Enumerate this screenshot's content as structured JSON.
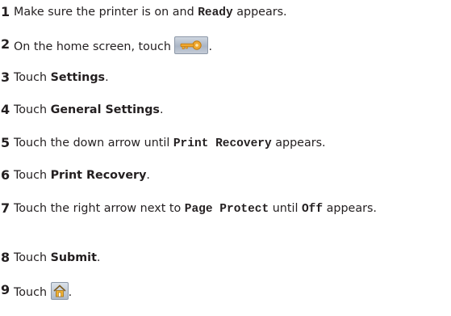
{
  "steps": [
    {
      "num": "1",
      "before": "Make sure the printer is on and ",
      "code": "Ready",
      "after": " appears."
    },
    {
      "num": "2",
      "before": "On the home screen, touch ",
      "icon": "menu-key-icon",
      "after": "."
    },
    {
      "num": "3",
      "before": "Touch ",
      "bold": "Settings",
      "after": "."
    },
    {
      "num": "4",
      "before": "Touch ",
      "bold": "General Settings",
      "after": "."
    },
    {
      "num": "5",
      "before": "Touch the down arrow until ",
      "code": "Print Recovery",
      "after": " appears."
    },
    {
      "num": "6",
      "before": "Touch ",
      "bold": "Print Recovery",
      "after": "."
    },
    {
      "num": "7",
      "before": "Touch the right arrow next to ",
      "code": "Page Protect",
      "middle": " until ",
      "code2": "Off",
      "after": " appears."
    },
    {
      "num": "8",
      "before": "Touch ",
      "bold": "Submit",
      "after": "."
    },
    {
      "num": "9",
      "before": "Touch ",
      "icon": "home-icon",
      "after": "."
    }
  ],
  "colors": {
    "text": "#231f20",
    "key_icon_body": "#b0bac8",
    "key_icon_accent": "#f0a830",
    "home_icon_accent": "#f0b030"
  }
}
